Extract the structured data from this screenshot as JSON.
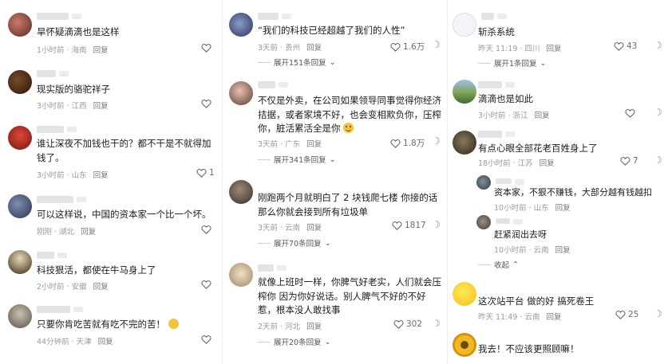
{
  "column1": [
    {
      "text": "旱怀疑滴滴也是这样",
      "meta": "1小时前 · 海南",
      "reply": "回复",
      "likes": ""
    },
    {
      "text": "现实版的骆驼祥子",
      "meta": "3小时前 · 江西",
      "reply": "回复",
      "likes": ""
    },
    {
      "text": "谁让深夜不加钱也干的？都不干是不就得加钱了。",
      "meta": "3小时前 · 山东",
      "reply": "回复",
      "likes": "1"
    },
    {
      "text": "可以这样说，中国的资本家一个比一个坏。",
      "meta": "刚刚 · 湖北",
      "reply": "回复",
      "likes": ""
    },
    {
      "text": "科技狠活，都使在牛马身上了",
      "meta": "2小时前 · 安徽",
      "reply": "回复",
      "likes": ""
    },
    {
      "text": "只要你肯吃苦就有吃不完的苦！",
      "meta": "44分钟前 · 天津",
      "reply": "回复",
      "likes": ""
    }
  ],
  "column2": [
    {
      "text": "“我们的科技已经超越了我们的人性”",
      "meta": "3天前 · 贵州",
      "reply": "回复",
      "likes": "1.6万",
      "expand": "展开151条回复"
    },
    {
      "text": "不仅是外卖，在公司如果领导同事觉得你经济拮据，或者家境不好，也会变相欺负你，压榨你，脏活累活全是你",
      "meta": "3天前 · 广东",
      "reply": "回复",
      "likes": "1.8万",
      "expand": "展开341条回复"
    },
    {
      "text": "刚跑两个月就明白了 2 块钱爬七楼 你接的话 那么你就会接到所有垃圾单",
      "meta": "3天前 · 云南",
      "reply": "回复",
      "likes": "1817",
      "expand": "展开70条回复"
    },
    {
      "text": "就像上班时一样，你脾气好老实，人们就会压榨你 因为你好说话。别人脾气不好的不好惹，根本没人敢找事",
      "meta": "2天前 · 河北",
      "reply": "回复",
      "likes": "302",
      "expand": "展开20条回复"
    }
  ],
  "column3": {
    "comments": [
      {
        "text": "斩杀系统",
        "meta": "昨天 11:19 · 四川",
        "reply": "回复",
        "likes": "43",
        "expand": "展开1条回复"
      },
      {
        "text": "滴滴也是如此",
        "meta": "3小时前 · 浙江",
        "reply": "回复",
        "likes": ""
      },
      {
        "text": "有点心眼全部花老百姓身上了",
        "meta": "18小时前 · 江苏",
        "reply": "回复",
        "likes": "7"
      }
    ],
    "replies": [
      {
        "text": "资本家，不狠不赚钱，大部分越有钱越扣",
        "meta": "10小时前 · 山东",
        "reply": "回复"
      },
      {
        "text": "赶紧润出去呀",
        "meta": "10小时前 · 云南",
        "reply": "回复"
      }
    ],
    "collapse": "收起",
    "comments2": [
      {
        "text": "这次站平台 做的好 搞死卷王",
        "meta": "昨天 11:49 · 云南",
        "reply": "回复",
        "likes": "25"
      },
      {
        "text": "我去！不应该更照顾嘛！",
        "meta": "",
        "reply": "",
        "likes": ""
      }
    ]
  }
}
